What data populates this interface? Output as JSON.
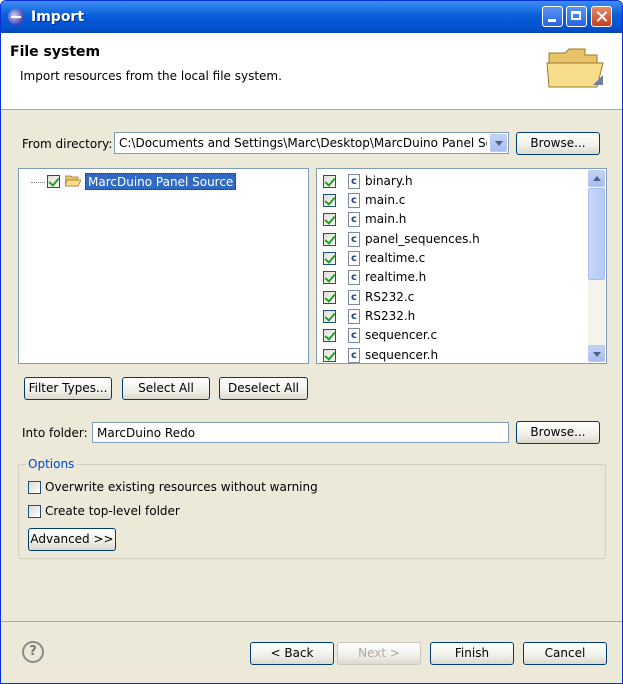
{
  "window": {
    "title": "Import"
  },
  "header": {
    "title": "File system",
    "description": "Import resources from the local file system."
  },
  "from_directory": {
    "label": "From directory:",
    "value": "C:\\Documents and Settings\\Marc\\Desktop\\MarcDuino Panel Source",
    "browse_label": "Browse..."
  },
  "tree": {
    "items": [
      {
        "label": "MarcDuino Panel Source",
        "checked": true
      }
    ]
  },
  "files": {
    "items": [
      {
        "label": "binary.h",
        "checked": true,
        "icon": "c-file-icon"
      },
      {
        "label": "main.c",
        "checked": true,
        "icon": "c-file-icon"
      },
      {
        "label": "main.h",
        "checked": true,
        "icon": "c-file-icon"
      },
      {
        "label": "panel_sequences.h",
        "checked": true,
        "icon": "c-file-icon"
      },
      {
        "label": "realtime.c",
        "checked": true,
        "icon": "c-file-icon"
      },
      {
        "label": "realtime.h",
        "checked": true,
        "icon": "c-file-icon"
      },
      {
        "label": "RS232.c",
        "checked": true,
        "icon": "c-file-icon"
      },
      {
        "label": "RS232.h",
        "checked": true,
        "icon": "c-file-icon"
      },
      {
        "label": "sequencer.c",
        "checked": true,
        "icon": "c-file-icon"
      },
      {
        "label": "sequencer.h",
        "checked": true,
        "icon": "c-file-icon"
      }
    ]
  },
  "selection_buttons": {
    "filter_types": "Filter Types...",
    "select_all": "Select All",
    "deselect_all": "Deselect All"
  },
  "into_folder": {
    "label": "Into folder:",
    "value": "MarcDuino Redo",
    "browse_label": "Browse..."
  },
  "options": {
    "group_label": "Options",
    "overwrite_label": "Overwrite existing resources without warning",
    "overwrite_checked": false,
    "create_top_label": "Create top-level folder",
    "create_top_checked": false,
    "advanced_label": "Advanced >>"
  },
  "footer": {
    "back_label": "< Back",
    "next_label": "Next >",
    "finish_label": "Finish",
    "cancel_label": "Cancel"
  },
  "colors": {
    "title_bar": "#0553d1",
    "selection": "#316ac5",
    "group_label": "#0046d5"
  }
}
